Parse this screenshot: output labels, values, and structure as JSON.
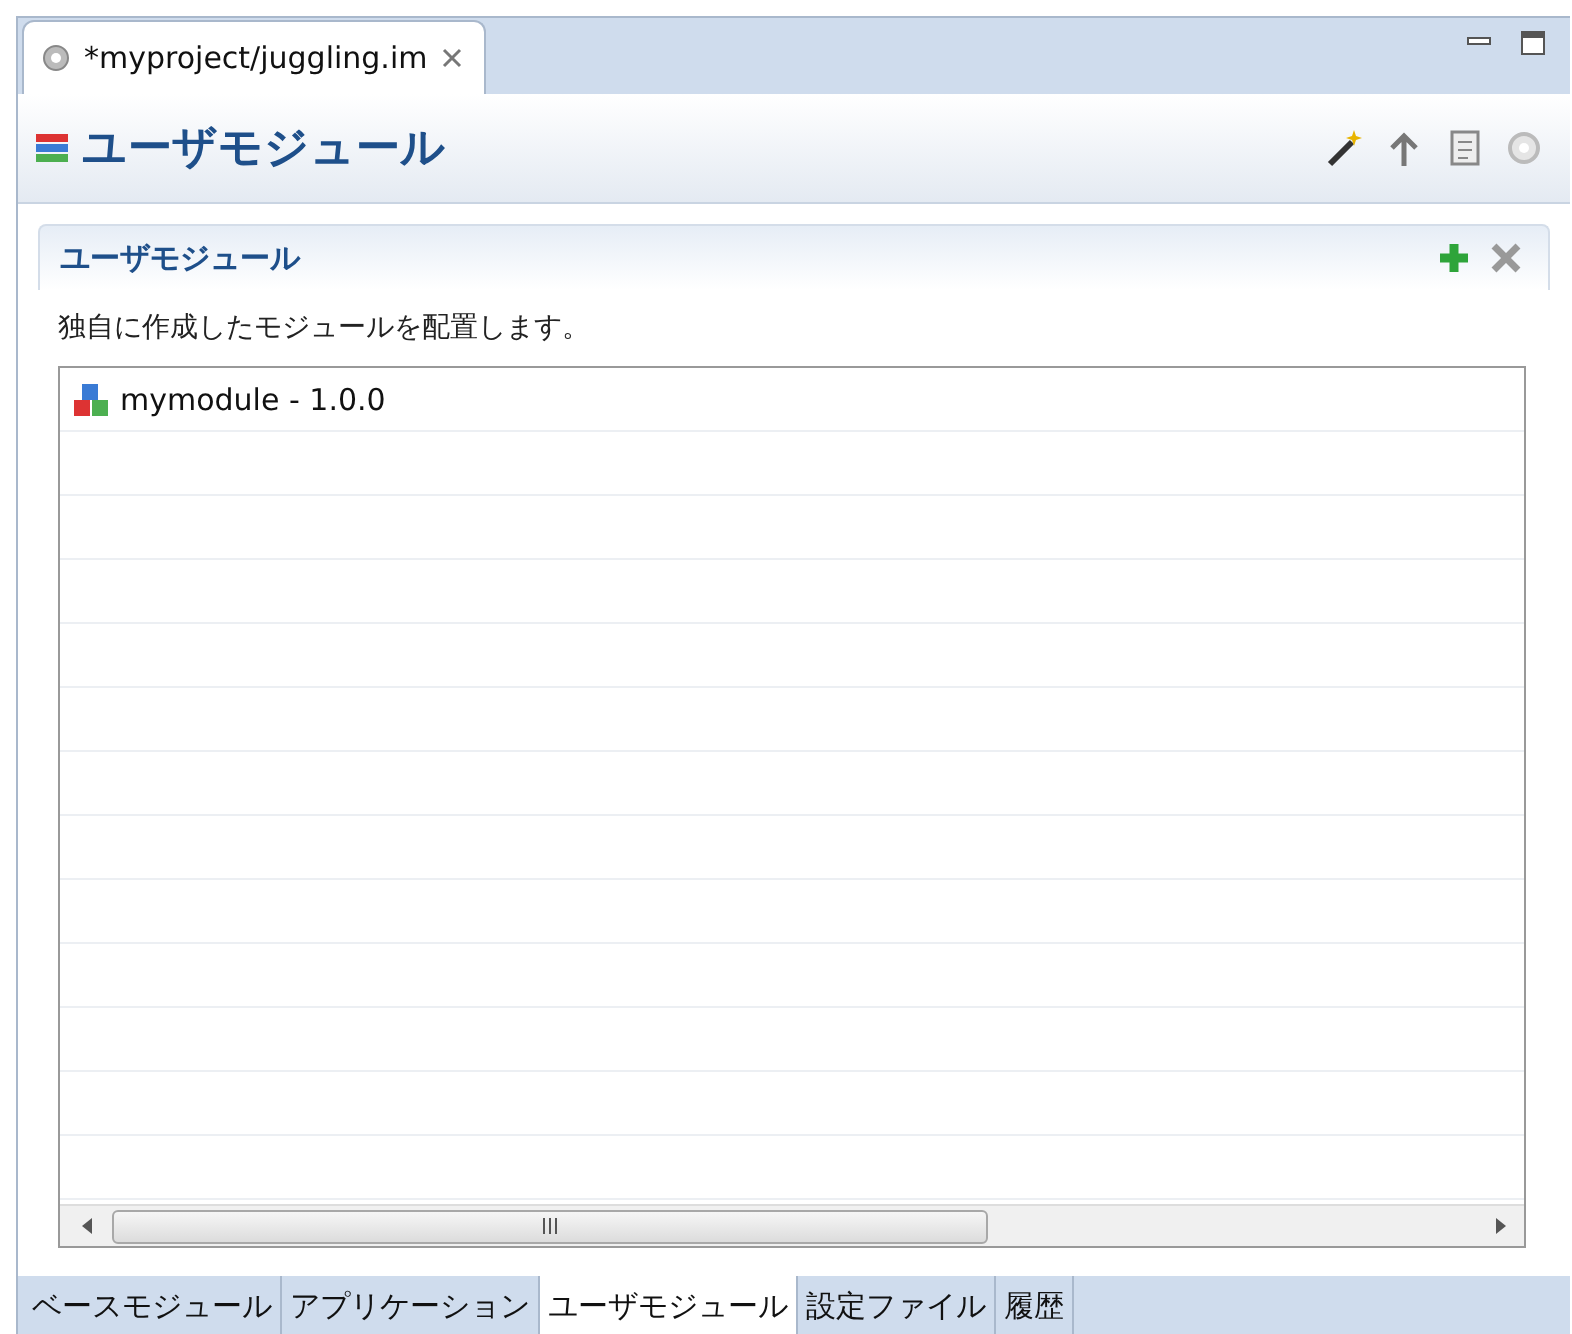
{
  "editor_tab": {
    "title": "*myproject/juggling.im",
    "selected": true
  },
  "page": {
    "title": "ユーザモジュール"
  },
  "section": {
    "title": "ユーザモジュール",
    "description": "独自に作成したモジュールを配置します。"
  },
  "modules": [
    {
      "label": "mymodule - 1.0.0",
      "selected": false
    }
  ],
  "bottom_tabs": [
    {
      "label": "ベースモジュール",
      "selected": false
    },
    {
      "label": "アプリケーション",
      "selected": false
    },
    {
      "label": "ユーザモジュール",
      "selected": true
    },
    {
      "label": "設定ファイル",
      "selected": false
    },
    {
      "label": "履歴",
      "selected": false
    }
  ]
}
